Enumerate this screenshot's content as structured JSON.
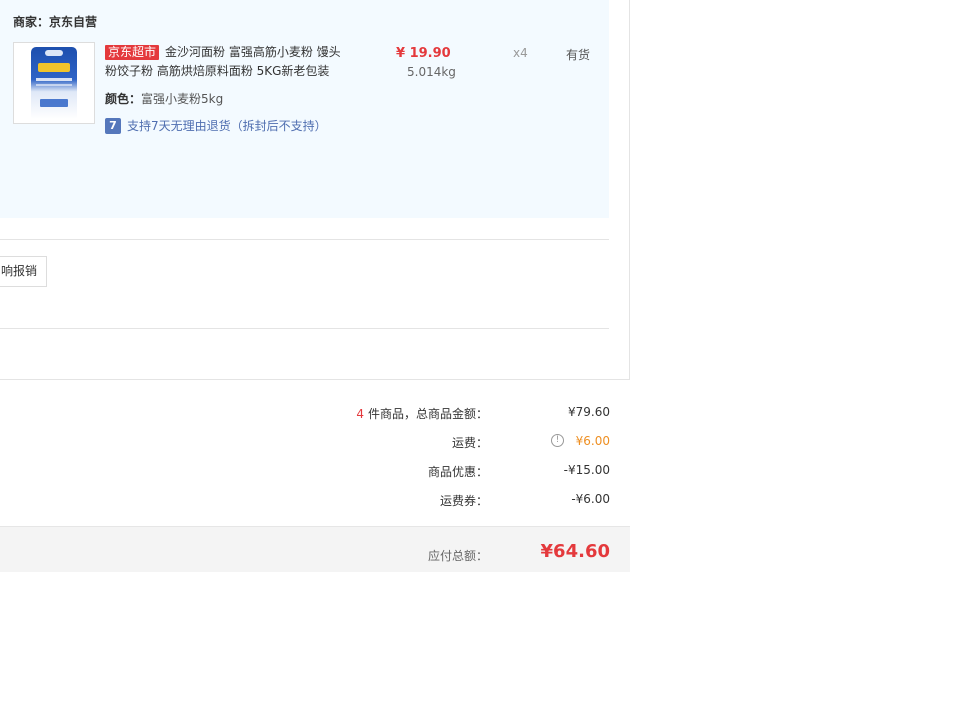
{
  "merchant": {
    "label": "商家：京东自营"
  },
  "product": {
    "tag": "京东超市",
    "title": "金沙河面粉 富强高筋小麦粉 馒头粉饺子粉 高筋烘焙原料面粉 5KG新老包装",
    "spec_label": "颜色：",
    "spec_value": "富强小麦粉5kg",
    "return_icon": "7",
    "return_text": "支持7天无理由退货（拆封后不支持）",
    "price": "¥ 19.90",
    "weight": "5.014kg",
    "qty": "x4",
    "stock": "有货"
  },
  "invoice": {
    "button_label": "响报销"
  },
  "summary": {
    "count": "4",
    "goods_label": "件商品，总商品金额：",
    "goods_value": "¥79.60",
    "shipping_label": "运费：",
    "shipping_icon": "!",
    "shipping_value": "¥6.00",
    "discount_label": "商品优惠：",
    "discount_value": "-¥15.00",
    "coupon_label": "运费券：",
    "coupon_value": "-¥6.00",
    "total_label": "应付总额：",
    "total_value": "¥64.60"
  },
  "colors": {
    "accent_red": "#e4393c",
    "shipping_orange": "#ee8f22",
    "panel_blue": "#f3faff",
    "link_blue": "#4f6eb0"
  },
  "icons": {
    "info": "info-icon",
    "return_badge": "seven-day-return-icon",
    "product_image": "flour-bag-image"
  }
}
